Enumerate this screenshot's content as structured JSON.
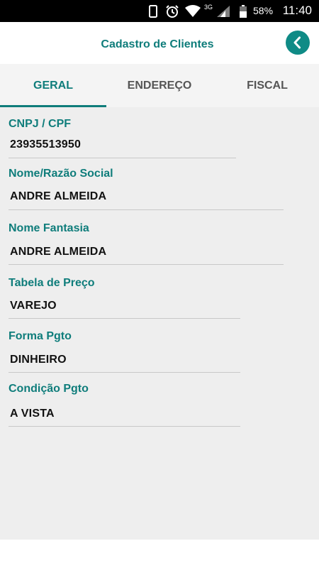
{
  "status_bar": {
    "icons": [
      "phone-icon",
      "alarm-icon",
      "wifi-icon",
      "signal-icon",
      "battery-icon"
    ],
    "network": "3G",
    "battery": "58%",
    "time": "11:40"
  },
  "header": {
    "title": "Cadastro de Clientes",
    "back_icon": "chevron-left-icon",
    "accent_color": "#0f7d7b"
  },
  "tabs": [
    {
      "label": "GERAL",
      "active": true
    },
    {
      "label": "ENDEREÇO",
      "active": false
    },
    {
      "label": "FISCAL",
      "active": false
    }
  ],
  "fields": [
    {
      "label": "CNPJ / CPF",
      "value": "23935513950"
    },
    {
      "label": "Nome/Razão Social",
      "value": "ANDRE ALMEIDA"
    },
    {
      "label": "Nome Fantasia",
      "value": "ANDRE ALMEIDA"
    },
    {
      "label": "Tabela de Preço",
      "value": "VAREJO"
    },
    {
      "label": "Forma Pgto",
      "value": "DINHEIRO"
    },
    {
      "label": "Condição Pgto",
      "value": "A VISTA"
    }
  ]
}
